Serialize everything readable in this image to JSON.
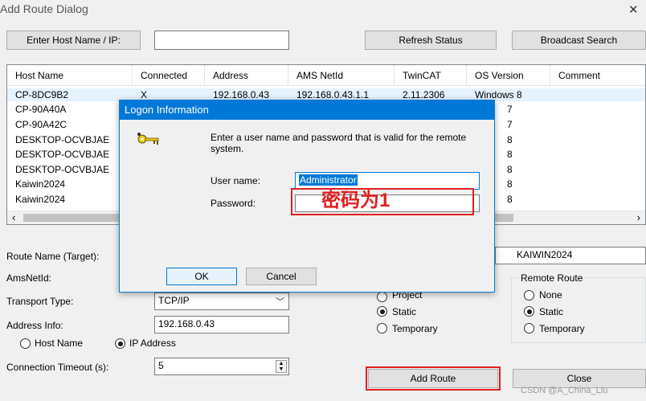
{
  "window": {
    "title": "Add Route Dialog",
    "close_glyph": "✕"
  },
  "toolbar": {
    "enter_host_label": "Enter Host Name / IP:",
    "host_input_value": "",
    "refresh_label": "Refresh Status",
    "broadcast_label": "Broadcast Search"
  },
  "host_list": {
    "columns": [
      "Host Name",
      "Connected",
      "Address",
      "AMS NetId",
      "TwinCAT",
      "OS Version",
      "Comment"
    ],
    "rows": [
      {
        "host": "CP-8DC9B2",
        "connected": "X",
        "address": "192.168.0.43",
        "netid": "192.168.0.43.1.1",
        "twincat": "2.11.2306",
        "os": "Windows 8"
      },
      {
        "host": "CP-90A40A",
        "os": "7"
      },
      {
        "host": "CP-90A42C",
        "os": "7"
      },
      {
        "host": "DESKTOP-OCVBJAE",
        "os": "8"
      },
      {
        "host": "DESKTOP-OCVBJAE",
        "os": "8"
      },
      {
        "host": "DESKTOP-OCVBJAE",
        "os": "8"
      },
      {
        "host": "Kaiwin2024",
        "os": "8"
      },
      {
        "host": "Kaiwin2024",
        "os": "8"
      }
    ]
  },
  "route_form": {
    "route_name_label": "Route Name (Target):",
    "route_name_value": "KAIWIN2024",
    "amsnetid_label": "AmsNetId:",
    "transport_label": "Transport Type:",
    "transport_value": "TCP/IP",
    "address_info_label": "Address Info:",
    "address_info_value": "192.168.0.43",
    "host_name_radio": "Host Name",
    "ip_address_radio": "IP Address",
    "timeout_label": "Connection Timeout (s):",
    "timeout_value": "5"
  },
  "local_route": {
    "project_label": "Project",
    "static_label": "Static",
    "temporary_label": "Temporary"
  },
  "remote_route": {
    "title": "Remote Route",
    "none_label": "None",
    "static_label": "Static",
    "temporary_label": "Temporary"
  },
  "buttons": {
    "add_route": "Add Route",
    "close": "Close"
  },
  "logon": {
    "title": "Logon Information",
    "message": "Enter a user name and password that is valid for the remote system.",
    "username_label": "User name:",
    "username_value": "Administrator",
    "password_label": "Password:",
    "password_value": "",
    "ok_label": "OK",
    "cancel_label": "Cancel"
  },
  "annotation": {
    "text": "密码为1",
    "color": "#e02020"
  },
  "watermark": "CSDN @A_China_Liu",
  "colors": {
    "titlebar": "#0078d7",
    "selection": "#0078d7",
    "highlight_box": "#e02020"
  }
}
